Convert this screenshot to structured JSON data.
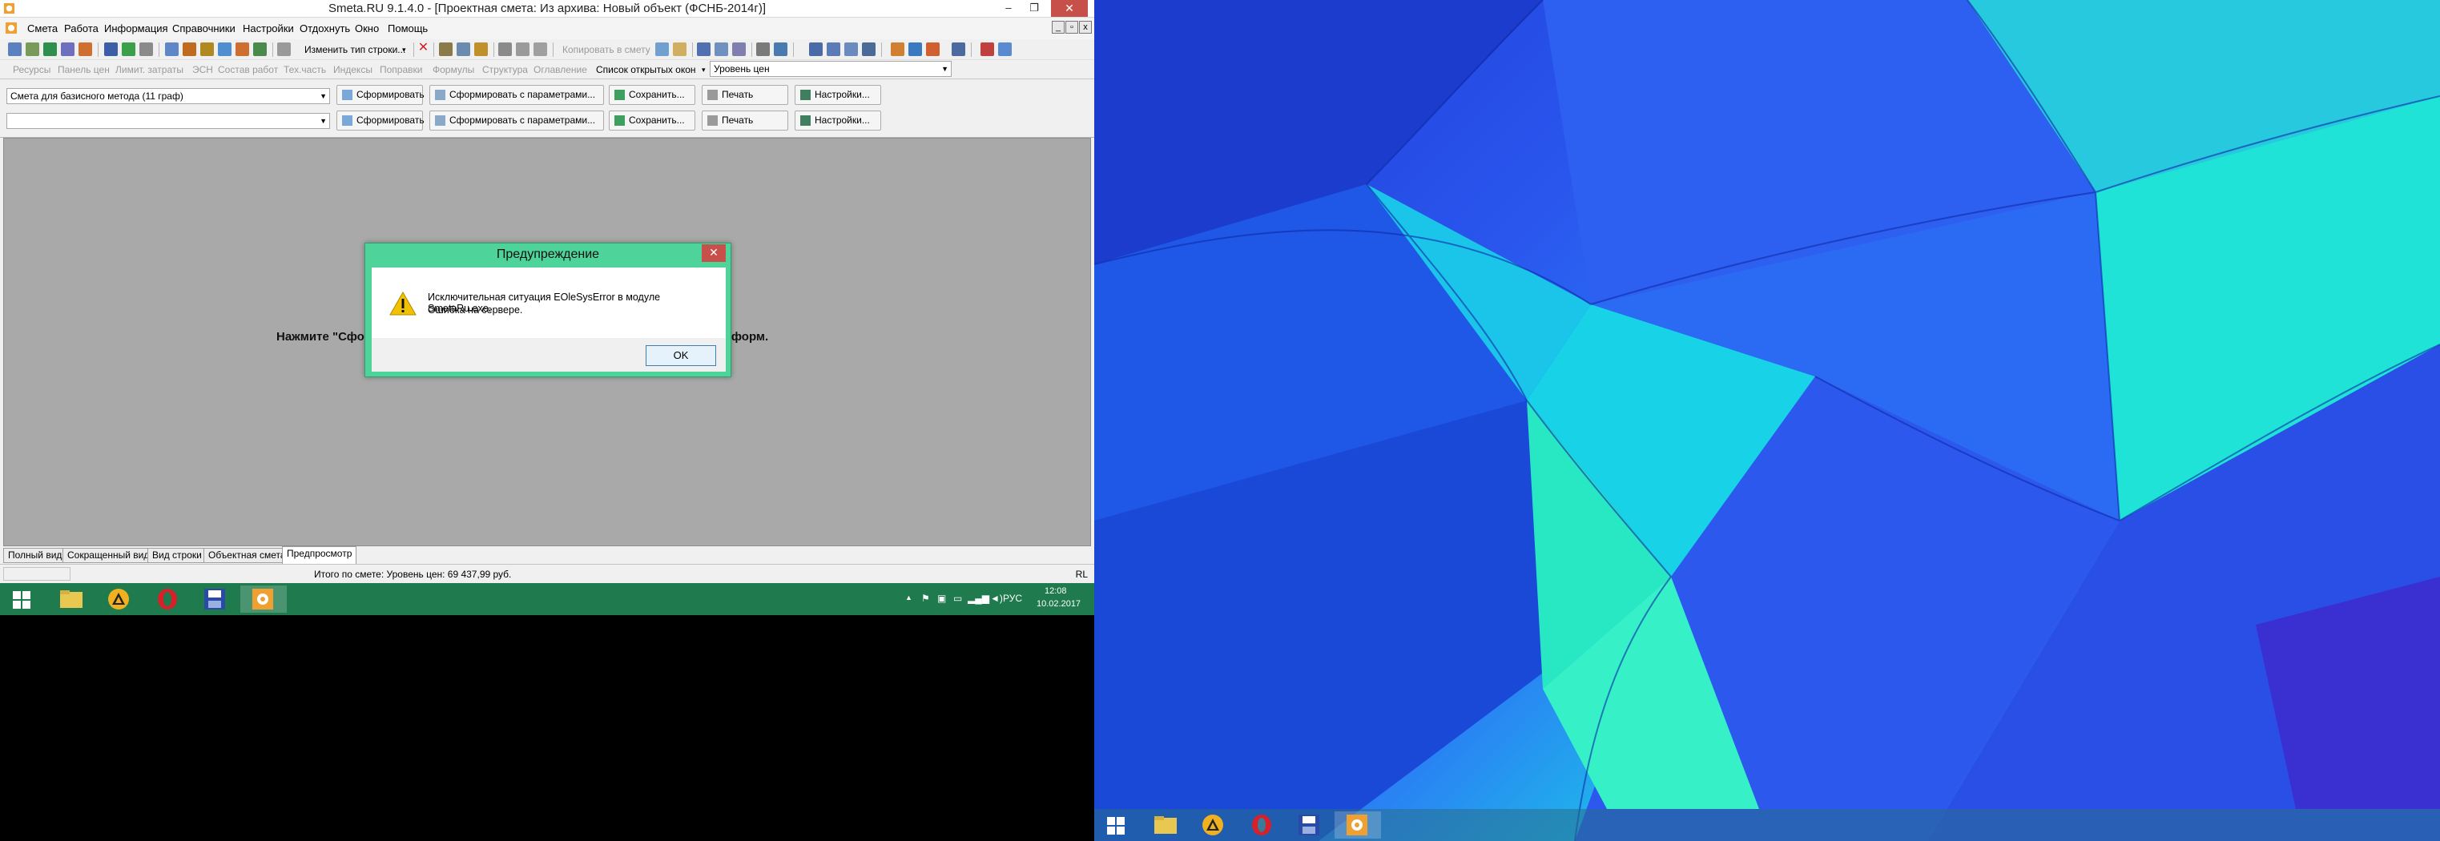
{
  "app": {
    "title": "Smeta.RU  9.1.4.0  - [Проектная смета: Из архива: Новый объект (ФСНБ-2014г)]",
    "minimize_glyph": "–",
    "restore_glyph": "❐",
    "close_glyph": "✕"
  },
  "menu": {
    "items": [
      "Смета",
      "Работа",
      "Информация",
      "Справочники",
      "Настройки",
      "Отдохнуть",
      "Окно",
      "Помощь"
    ],
    "mdi_min": "_",
    "mdi_restore": "▫",
    "mdi_close": "x"
  },
  "toolbar1": {
    "change_row_type": "Изменить тип строки...",
    "change_row_type_arrow": "▾",
    "copy_to_estimate": "Копировать в смету"
  },
  "toolbar2": {
    "items": [
      "Ресурсы",
      "Панель цен",
      "Лимит. затраты",
      "ЭСН",
      "Состав работ",
      "Тех.часть",
      "Индексы",
      "Поправки",
      "Формулы",
      "Структура",
      "Оглавление"
    ],
    "open_windows_label": "Список открытых окон",
    "price_level_value": "Уровень цен"
  },
  "panel": {
    "row1_combo": "Смета для базисного метода  (11 граф)",
    "row2_combo": "",
    "btn_form": "Сформировать",
    "btn_form_params": "Сформировать с параметрами...",
    "btn_save": "Сохранить...",
    "btn_print": "Печать",
    "btn_settings": "Настройки..."
  },
  "workarea": {
    "hint_left": "Нажмите \"Сфо",
    "hint_right": "одных форм."
  },
  "dialog": {
    "title": "Предупреждение",
    "close_glyph": "✕",
    "message_line1": "Исключительная ситуация EOleSysError в модуле SmetaRu.exe.",
    "message_line2": "Ошибка на сервере.",
    "ok_label": "OK"
  },
  "tabs": [
    "Полный вид",
    "Сокращенный вид",
    "Вид строки",
    "Объектная смета",
    "Предпросмотр"
  ],
  "status": {
    "total": "Итого по смете: Уровень цен: 69 437,99 руб.",
    "lang": "RL"
  },
  "tray": {
    "expand": "▲",
    "lang": "РУС",
    "time": "12:08",
    "date": "10.02.2017"
  },
  "colors": {
    "taskbar_left": "#1f7a4e",
    "dialog_frame": "#4ed49a",
    "workarea_bg": "#a9a9a9",
    "close_red": "#c7504a"
  }
}
